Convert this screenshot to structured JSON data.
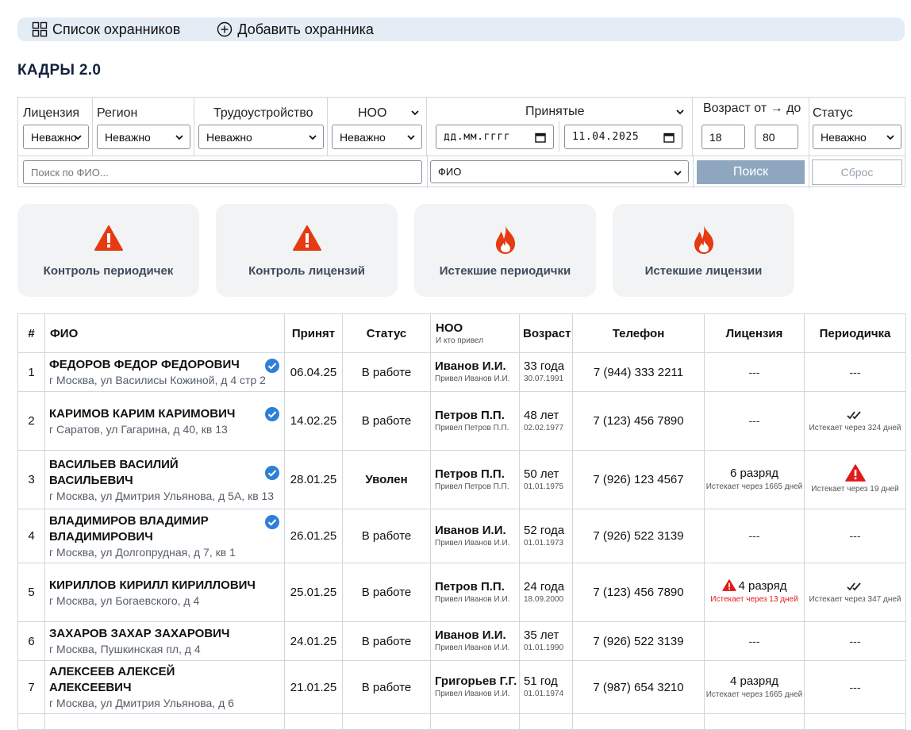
{
  "nav": {
    "list_label": "Список охранников",
    "add_label": "Добавить охранника"
  },
  "page_title": "КАДРЫ 2.0",
  "filters": {
    "license": {
      "label": "Лицензия",
      "value": "Неважно"
    },
    "region": {
      "label": "Регион",
      "value": "Неважно"
    },
    "employment": {
      "label": "Трудоустройство",
      "value": "Неважно"
    },
    "noo": {
      "label": "НОО",
      "value": "Неважно"
    },
    "hired": {
      "label": "Принятые",
      "from": "дд.мм.гггг",
      "to": "11.04.2025"
    },
    "age": {
      "label": "Возраст от → до",
      "from": "18",
      "to": "80"
    },
    "status": {
      "label": "Статус",
      "value": "Неважно"
    },
    "search_placeholder": "Поиск по ФИО...",
    "search_field": "ФИО",
    "search_button": "Поиск",
    "reset_button": "Сброс"
  },
  "cards": [
    {
      "label": "Контроль периодичек",
      "icon": "warning-icon"
    },
    {
      "label": "Контроль лицензий",
      "icon": "warning-icon"
    },
    {
      "label": "Истекшие периодички",
      "icon": "fire-icon"
    },
    {
      "label": "Истекшие лицензии",
      "icon": "fire-icon"
    }
  ],
  "table": {
    "headers": {
      "num": "#",
      "fio": "ФИО",
      "hired": "Принят",
      "status": "Статус",
      "noo": "НОО",
      "noo_sub": "И кто привел",
      "age": "Возраст",
      "phone": "Телефон",
      "license": "Лицензия",
      "periodic": "Периодичка"
    },
    "rows": [
      {
        "num": "1",
        "name": "ФЕДОРОВ ФЕДОР ФЕДОРОВИЧ",
        "addr": "г Москва, ул Василисы Кожиной, д 4 стр 2",
        "hired": "06.04.25",
        "status": "В работе",
        "noo": "Иванов И.И.",
        "noo_sub": "Привел Иванов И.И.",
        "age": "33 года",
        "dob": "30.07.1991",
        "phone": "7 (944) 333 2211",
        "license_dash": "---",
        "periodic_dash": "---"
      },
      {
        "num": "2",
        "name": "КАРИМОВ КАРИМ КАРИМОВИЧ",
        "addr": "г Саратов, ул Гагарина, д 40, кв 13",
        "hired": "14.02.25",
        "status": "В работе",
        "noo": "Петров П.П.",
        "noo_sub": "Привел Петров П.П.",
        "age": "48 лет",
        "dob": "02.02.1977",
        "phone": "7 (123) 456 7890",
        "license_dash": "---",
        "periodic_note": "Истекает через 324 дней"
      },
      {
        "num": "3",
        "name": "ВАСИЛЬЕВ ВАСИЛИЙ ВАСИЛЬЕВИЧ",
        "addr": "г Москва, ул Дмитрия Ульянова, д 5А, кв 13",
        "hired": "28.01.25",
        "status": "Уволен",
        "noo": "Петров П.П.",
        "noo_sub": "Привел Петров П.П.",
        "age": "50 лет",
        "dob": "01.01.1975",
        "phone": "7 (926) 123 4567",
        "license": "6 разряд",
        "license_note": "Истекает через 1665 дней",
        "periodic_note": "Истекает через 19 дней"
      },
      {
        "num": "4",
        "name": "ВЛАДИМИРОВ ВЛАДИМИР ВЛАДИМИРОВИЧ",
        "addr": "г Москва, ул Долгопрудная, д 7, кв 1",
        "hired": "26.01.25",
        "status": "В работе",
        "noo": "Иванов И.И.",
        "noo_sub": "Привел Иванов И.И.",
        "age": "52 года",
        "dob": "01.01.1973",
        "phone": "7 (926) 522 3139",
        "license_dash": "---",
        "periodic_dash": "---"
      },
      {
        "num": "5",
        "name": "КИРИЛЛОВ КИРИЛЛ КИРИЛЛОВИЧ",
        "addr": "г Москва, ул Богаевского, д 4",
        "hired": "25.01.25",
        "status": "В работе",
        "noo": "Петров П.П.",
        "noo_sub": "Привел Иванов И.И.",
        "age": "24 года",
        "dob": "18.09.2000",
        "phone": "7 (123) 456 7890",
        "license": "4 разряд",
        "license_note": "Истекает через 13 дней",
        "periodic_note": "Истекает через 347 дней"
      },
      {
        "num": "6",
        "name": "ЗАХАРОВ ЗАХАР ЗАХАРОВИЧ",
        "addr": "г Москва, Пушкинская пл, д 4",
        "hired": "24.01.25",
        "status": "В работе",
        "noo": "Иванов И.И.",
        "noo_sub": "Привел Иванов И.И.",
        "age": "35 лет",
        "dob": "01.01.1990",
        "phone": "7 (926) 522 3139",
        "license_dash": "---",
        "periodic_dash": "---"
      },
      {
        "num": "7",
        "name": "АЛЕКСЕЕВ АЛЕКСЕЙ АЛЕКСЕЕВИЧ",
        "addr": "г Москва, ул Дмитрия Ульянова, д 6",
        "hired": "21.01.25",
        "status": "В работе",
        "noo": "Григорьев Г.Г.",
        "noo_sub": "Привел Иванов И.И.",
        "age": "51 год",
        "dob": "01.01.1974",
        "phone": "7 (987) 654 3210",
        "license": "4 разряд",
        "license_note": "Истекает через 1665 дней",
        "periodic_dash": "---"
      }
    ]
  },
  "colors": {
    "accent": "#e53a12",
    "warning_red": "#e01b1b",
    "verified_blue": "#2f7fd6",
    "button_disabled": "#8fa7be"
  }
}
